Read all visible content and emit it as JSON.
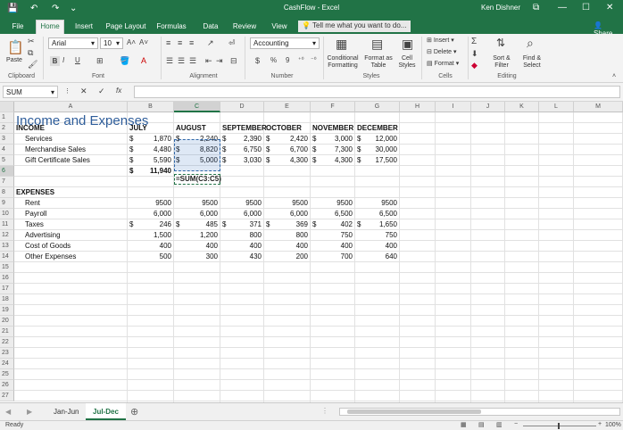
{
  "app": {
    "title": "CashFlow - Excel",
    "user": "Ken Dishner",
    "qa_save": "💾",
    "qa_undo": "↶",
    "qa_redo": "↷",
    "qa_more": "⌄",
    "win_restore": "⧉",
    "win_min": "—",
    "win_max": "☐",
    "win_close": "✕"
  },
  "menu": {
    "tabs": [
      "File",
      "Home",
      "Insert",
      "Page Layout",
      "Formulas",
      "Data",
      "Review",
      "View"
    ],
    "active": "Home",
    "tellme": "Tell me what you want to do...",
    "share": "Share"
  },
  "ribbon": {
    "clipboard": {
      "label": "Clipboard",
      "paste": "Paste"
    },
    "font": {
      "label": "Font",
      "name": "Arial",
      "size": "10",
      "bold": "B",
      "italic": "I",
      "underline": "U",
      "grow": "A˄",
      "shrink": "A˅"
    },
    "alignment": {
      "label": "Alignment"
    },
    "number": {
      "label": "Number",
      "format": "Accounting",
      "currency": "$",
      "percent": "%",
      "comma": "9"
    },
    "styles": {
      "label": "Styles",
      "conditional": "Conditional Formatting",
      "format_table": "Format as Table",
      "cell_styles": "Cell Styles"
    },
    "cells": {
      "label": "Cells",
      "insert": "Insert",
      "delete": "Delete",
      "format": "Format"
    },
    "editing": {
      "label": "Editing",
      "sort": "Sort & Filter",
      "find": "Find & Select"
    }
  },
  "formula_bar": {
    "name_box": "SUM",
    "cancel": "✕",
    "enter": "✓",
    "fx": "fx",
    "content": ""
  },
  "sheet": {
    "columns": [
      "A",
      "B",
      "C",
      "D",
      "E",
      "F",
      "G",
      "H",
      "I",
      "J",
      "K",
      "L",
      "M"
    ],
    "title": "Income and Expenses",
    "income_header": [
      "INCOME",
      "JULY",
      "AUGUST",
      "SEPTEMBER",
      "OCTOBER",
      "NOVEMBER",
      "DECEMBER"
    ],
    "income_rows": [
      {
        "label": "Services",
        "c1": "$",
        "b": "1,870",
        "c2": "$",
        "c": "2,240",
        "c3": "$",
        "d": "2,390",
        "c4": "$",
        "e": "2,420",
        "c5": "$",
        "f": "3,000",
        "c6": "$",
        "g": "12,000"
      },
      {
        "label": "Merchandise Sales",
        "c1": "$",
        "b": "4,480",
        "c2": "$",
        "c": "8,820",
        "c3": "$",
        "d": "6,750",
        "c4": "$",
        "e": "6,700",
        "c5": "$",
        "f": "7,300",
        "c6": "$",
        "g": "30,000"
      },
      {
        "label": "Gift Certificate Sales",
        "c1": "$",
        "b": "5,590",
        "c2": "$",
        "c": "5,000",
        "c3": "$",
        "d": "3,030",
        "c4": "$",
        "e": "4,300",
        "c5": "$",
        "f": "4,300",
        "c6": "$",
        "g": "17,500"
      }
    ],
    "total_july_symbol": "$",
    "total_july": "11,940",
    "editing_formula": "=SUM(C3:C5)",
    "expenses_header": "EXPENSES",
    "expense_rows": [
      {
        "label": "Rent",
        "c1": "",
        "b": "9500",
        "c2": "",
        "c": "9500",
        "c3": "",
        "d": "9500",
        "c4": "",
        "e": "9500",
        "c5": "",
        "f": "9500",
        "c6": "",
        "g": "9500"
      },
      {
        "label": "Payroll",
        "c1": "",
        "b": "6,000",
        "c2": "",
        "c": "6,000",
        "c3": "",
        "d": "6,000",
        "c4": "",
        "e": "6,000",
        "c5": "",
        "f": "6,500",
        "c6": "",
        "g": "6,500"
      },
      {
        "label": "Taxes",
        "c1": "$",
        "b": "246",
        "c2": "$",
        "c": "485",
        "c3": "$",
        "d": "371",
        "c4": "$",
        "e": "369",
        "c5": "$",
        "f": "402",
        "c6": "$",
        "g": "1,650"
      },
      {
        "label": "Advertising",
        "c1": "",
        "b": "1,500",
        "c2": "",
        "c": "1,200",
        "c3": "",
        "d": "800",
        "c4": "",
        "e": "800",
        "c5": "",
        "f": "750",
        "c6": "",
        "g": "750"
      },
      {
        "label": "Cost of Goods",
        "c1": "",
        "b": "400",
        "c2": "",
        "c": "400",
        "c3": "",
        "d": "400",
        "c4": "",
        "e": "400",
        "c5": "",
        "f": "400",
        "c6": "",
        "g": "400"
      },
      {
        "label": "Other Expenses",
        "c1": "",
        "b": "500",
        "c2": "",
        "c": "300",
        "c3": "",
        "d": "430",
        "c4": "",
        "e": "200",
        "c5": "",
        "f": "700",
        "c6": "",
        "g": "640"
      }
    ]
  },
  "sheet_tabs": {
    "tabs": [
      "Jan-Jun",
      "Jul-Dec"
    ],
    "active": "Jul-Dec",
    "add": "⊕"
  },
  "status": {
    "mode": "Ready",
    "zoom": "100%"
  }
}
